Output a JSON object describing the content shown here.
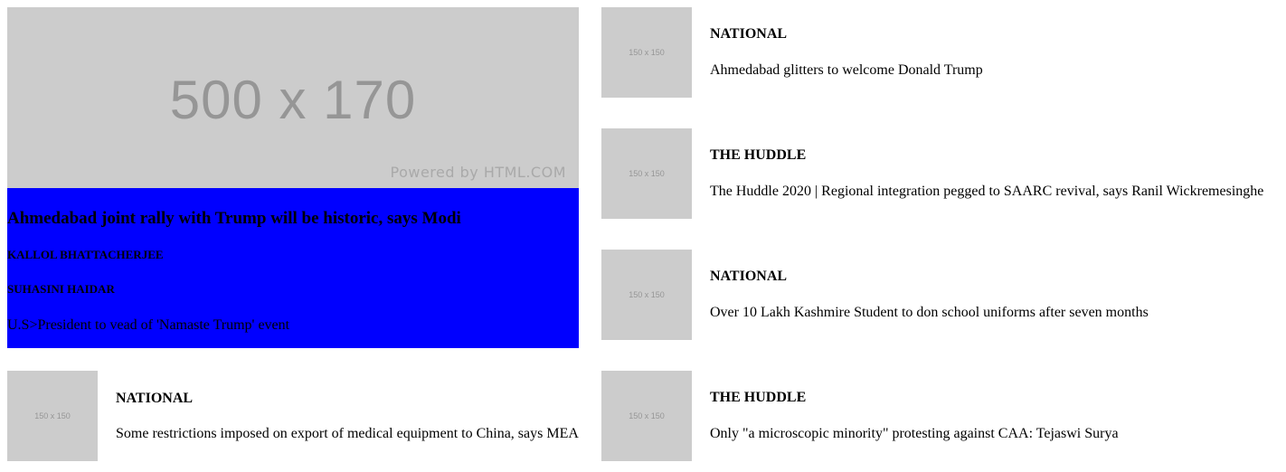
{
  "featured": {
    "image_size_label": "500 x 170",
    "image_credit": "Powered by HTML.COM",
    "title": "Ahmedabad joint rally with Trump will be historic, says Modi",
    "authors": [
      "KALLOL BHATTACHERJEE",
      "SUHASINI HAIDAR"
    ],
    "description": "U.S>President to vead of 'Namaste Trump' event",
    "background_color": "#0000ff"
  },
  "stories": [
    {
      "thumb_label": "150 x 150",
      "category": "NATIONAL",
      "headline": "Ahmedabad glitters to welcome Donald Trump"
    },
    {
      "thumb_label": "150 x 150",
      "category": "THE HUDDLE",
      "headline": "The Huddle 2020 | Regional integration pegged to SAARC revival, says Ranil Wickremesinghe"
    },
    {
      "thumb_label": "150 x 150",
      "category": "NATIONAL",
      "headline": "Over 10 Lakh Kashmire Student to don school uniforms after seven months"
    },
    {
      "thumb_label": "150 x 150",
      "category": "NATIONAL",
      "headline": "Some restrictions imposed on export of medical equipment to China, says MEA"
    },
    {
      "thumb_label": "150 x 150",
      "category": "THE HUDDLE",
      "headline": "Only \"a microscopic minority\" protesting against CAA: Tejaswi Surya"
    }
  ]
}
